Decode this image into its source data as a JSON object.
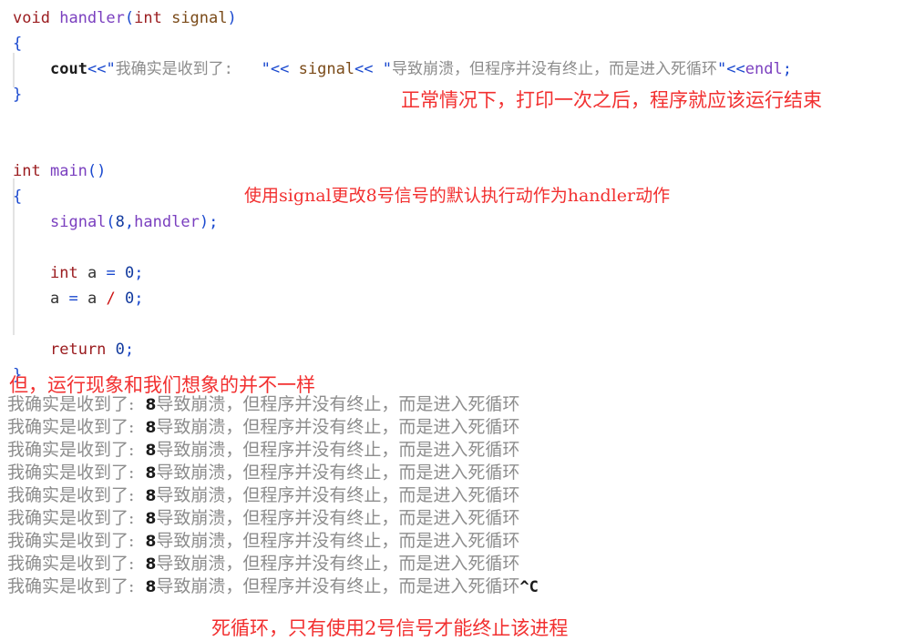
{
  "code": {
    "lines": [
      {
        "id": "func-signature",
        "indent": 0,
        "tokens": [
          {
            "cls": "kw",
            "t": "void"
          },
          {
            "cls": "plain",
            "t": " "
          },
          {
            "cls": "fn",
            "t": "handler"
          },
          {
            "cls": "punct",
            "t": "("
          },
          {
            "cls": "kw",
            "t": "int"
          },
          {
            "cls": "plain",
            "t": " "
          },
          {
            "cls": "param",
            "t": "signal"
          },
          {
            "cls": "punct",
            "t": ")"
          }
        ]
      },
      {
        "id": "func-open-brace",
        "indent": 0,
        "tokens": [
          {
            "cls": "punct",
            "t": "{"
          }
        ]
      },
      {
        "id": "cout-statement",
        "indent": 2,
        "tokens": [
          {
            "cls": "obj",
            "t": "cout"
          },
          {
            "cls": "op",
            "t": "<<"
          },
          {
            "cls": "quote",
            "t": "\""
          },
          {
            "cls": "str",
            "t": "我确实是收到了:   "
          },
          {
            "cls": "quote",
            "t": "\""
          },
          {
            "cls": "op",
            "t": "<<"
          },
          {
            "cls": "plain",
            "t": " "
          },
          {
            "cls": "param",
            "t": "signal"
          },
          {
            "cls": "op",
            "t": "<<"
          },
          {
            "cls": "plain",
            "t": " "
          },
          {
            "cls": "quote",
            "t": "\""
          },
          {
            "cls": "str",
            "t": "导致崩溃，但程序并没有终止，而是进入死循环"
          },
          {
            "cls": "quote",
            "t": "\""
          },
          {
            "cls": "op",
            "t": "<<"
          },
          {
            "cls": "fn",
            "t": "endl"
          },
          {
            "cls": "punct",
            "t": ";"
          }
        ]
      },
      {
        "id": "func-close-brace",
        "indent": 0,
        "tokens": [
          {
            "cls": "punct",
            "t": "}"
          }
        ]
      },
      {
        "id": "blank-1",
        "indent": 0,
        "tokens": [
          {
            "cls": "plain",
            "t": " "
          }
        ]
      },
      {
        "id": "blank-2",
        "indent": 0,
        "tokens": [
          {
            "cls": "plain",
            "t": " "
          }
        ]
      },
      {
        "id": "main-signature",
        "indent": 0,
        "tokens": [
          {
            "cls": "kw",
            "t": "int"
          },
          {
            "cls": "plain",
            "t": " "
          },
          {
            "cls": "fn",
            "t": "main"
          },
          {
            "cls": "punct",
            "t": "()"
          }
        ]
      },
      {
        "id": "main-open-brace",
        "indent": 0,
        "tokens": [
          {
            "cls": "punct",
            "t": "{"
          }
        ]
      },
      {
        "id": "signal-call",
        "indent": 2,
        "tokens": [
          {
            "cls": "fn",
            "t": "signal"
          },
          {
            "cls": "punct",
            "t": "("
          },
          {
            "cls": "num",
            "t": "8"
          },
          {
            "cls": "punct",
            "t": ","
          },
          {
            "cls": "fn",
            "t": "handler"
          },
          {
            "cls": "punct",
            "t": ");"
          }
        ]
      },
      {
        "id": "blank-3",
        "indent": 0,
        "tokens": [
          {
            "cls": "plain",
            "t": " "
          }
        ]
      },
      {
        "id": "declare-a",
        "indent": 2,
        "tokens": [
          {
            "cls": "kw",
            "t": "int"
          },
          {
            "cls": "plain",
            "t": " "
          },
          {
            "cls": "var",
            "t": "a"
          },
          {
            "cls": "plain",
            "t": " "
          },
          {
            "cls": "op",
            "t": "="
          },
          {
            "cls": "plain",
            "t": " "
          },
          {
            "cls": "num",
            "t": "0"
          },
          {
            "cls": "punct",
            "t": ";"
          }
        ]
      },
      {
        "id": "divide-by-zero",
        "indent": 2,
        "tokens": [
          {
            "cls": "var",
            "t": "a"
          },
          {
            "cls": "plain",
            "t": " "
          },
          {
            "cls": "op",
            "t": "="
          },
          {
            "cls": "plain",
            "t": " "
          },
          {
            "cls": "var",
            "t": "a"
          },
          {
            "cls": "plain",
            "t": " "
          },
          {
            "cls": "slash",
            "t": "/"
          },
          {
            "cls": "plain",
            "t": " "
          },
          {
            "cls": "num",
            "t": "0"
          },
          {
            "cls": "punct",
            "t": ";"
          }
        ]
      },
      {
        "id": "blank-4",
        "indent": 0,
        "tokens": [
          {
            "cls": "plain",
            "t": " "
          }
        ]
      },
      {
        "id": "return-statement",
        "indent": 2,
        "tokens": [
          {
            "cls": "kw",
            "t": "return"
          },
          {
            "cls": "plain",
            "t": " "
          },
          {
            "cls": "num",
            "t": "0"
          },
          {
            "cls": "punct",
            "t": ";"
          }
        ]
      },
      {
        "id": "main-close-brace",
        "indent": 0,
        "tokens": [
          {
            "cls": "punct",
            "t": "}"
          }
        ]
      }
    ]
  },
  "annotations": {
    "normal_case": "正常情况下，打印一次之后，程序就应该运行结束",
    "signal_usage": "使用signal更改8号信号的默认执行动作为handler动作",
    "unexpected_behavior": "但，运行现象和我们想象的并不一样",
    "conclusion": "死循环，只有使用2号信号才能终止该进程"
  },
  "terminal": {
    "prefix": "我确实是收到了:  ",
    "signal_number": "8",
    "suffix": "导致崩溃，但程序并没有终止，而是进入死循环",
    "ctrl_c": "^C",
    "line_count": 9
  },
  "colors": {
    "annotation_red": "#f23030",
    "keyword": "#9b1d20",
    "identifier": "#7a3fbf",
    "punctuation": "#1a49cf",
    "string": "#8c8c8c",
    "number": "#123a9e",
    "terminal_text": "#8d8d8d",
    "indent_guide": "#e3e3e3"
  }
}
